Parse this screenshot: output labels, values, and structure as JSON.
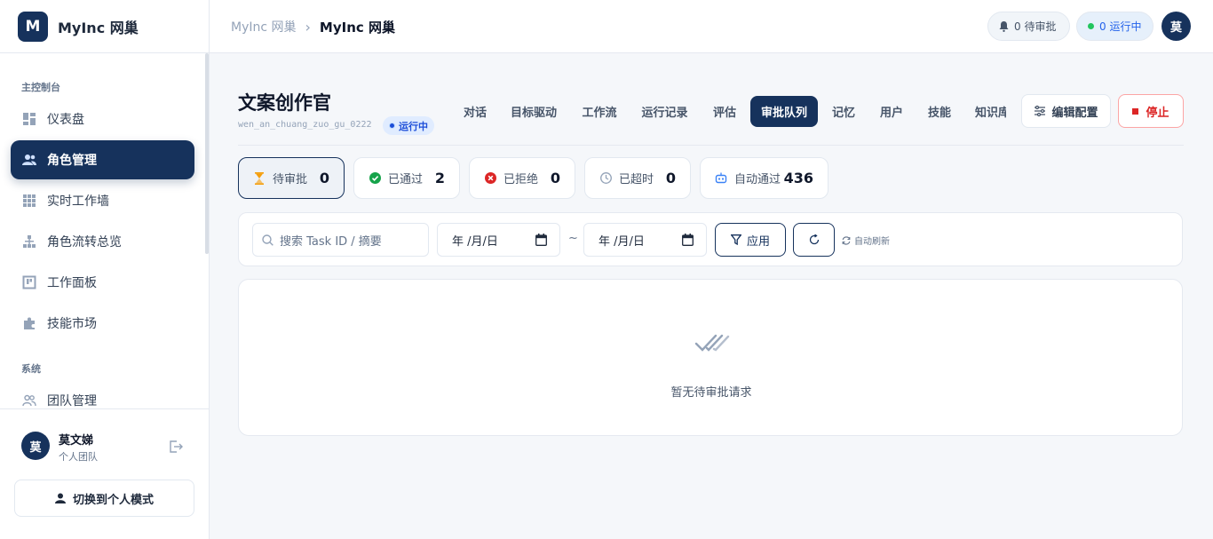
{
  "brand": {
    "logo_letter": "M",
    "name": "MyInc 网巢"
  },
  "sidebar": {
    "section_main": "主控制台",
    "items": [
      {
        "label": "仪表盘",
        "icon": "dashboard-icon"
      },
      {
        "label": "角色管理",
        "icon": "users-icon",
        "active": true
      },
      {
        "label": "实时工作墙",
        "icon": "grid-icon"
      },
      {
        "label": "角色流转总览",
        "icon": "hierarchy-icon"
      },
      {
        "label": "工作面板",
        "icon": "board-icon"
      },
      {
        "label": "技能市场",
        "icon": "puzzle-icon"
      }
    ],
    "section_system": "系统",
    "system_items": [
      {
        "label": "团队管理",
        "icon": "team-icon"
      }
    ],
    "user": {
      "avatar": "莫",
      "name": "莫文娣",
      "team": "个人团队"
    },
    "switch_label": "切换到个人模式"
  },
  "header": {
    "breadcrumb_parent": "MyInc 网巢",
    "breadcrumb_separator": "›",
    "breadcrumb_current": "MyInc 网巢",
    "pending_label": "0 待审批",
    "running_label": "0 运行中",
    "avatar": "莫"
  },
  "agent": {
    "title": "文案创作官",
    "slug": "wen_an_chuang_zuo_gu_0222",
    "status": "运行中"
  },
  "tabs": [
    "对话",
    "目标驱动",
    "工作流",
    "运行记录",
    "评估",
    "审批队列",
    "记忆",
    "用户",
    "技能",
    "知识库"
  ],
  "active_tab": "审批队列",
  "actions": {
    "edit_config": "编辑配置",
    "stop": "停止"
  },
  "stats": [
    {
      "label": "待审批",
      "value": "0",
      "icon": "hourglass-icon",
      "color": "#f59e0b"
    },
    {
      "label": "已通过",
      "value": "2",
      "icon": "check-circle-icon",
      "color": "#16a34a"
    },
    {
      "label": "已拒绝",
      "value": "0",
      "icon": "x-circle-icon",
      "color": "#dc2626"
    },
    {
      "label": "已超时",
      "value": "0",
      "icon": "clock-icon",
      "color": "#94a3b8"
    },
    {
      "label": "自动通过",
      "value": "436",
      "icon": "robot-icon",
      "color": "#3b82f6"
    }
  ],
  "filters": {
    "search_placeholder": "搜索 Task ID / 摘要",
    "date_from": "年 /月/日",
    "date_separator": "~",
    "date_to": "年 /月/日",
    "apply_label": "应用",
    "auto_refresh_label": "自动刷新"
  },
  "empty": {
    "message": "暂无待审批请求"
  },
  "colors": {
    "primary": "#16325c",
    "danger": "#dc2626",
    "success": "#22c55e"
  }
}
